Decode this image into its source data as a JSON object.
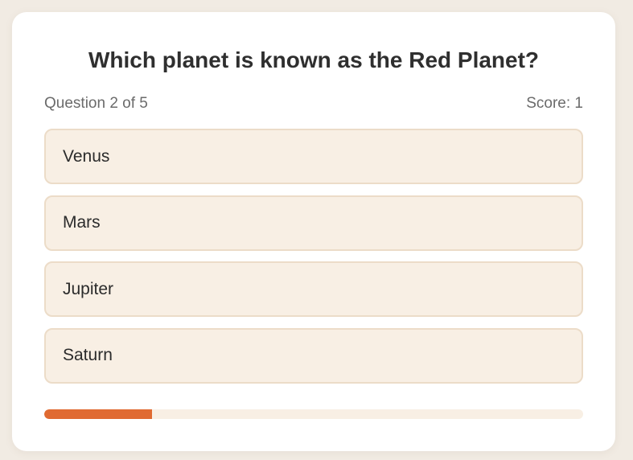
{
  "quiz": {
    "question": "Which planet is known as the Red Planet?",
    "progress_text": "Question 2 of 5",
    "score_text": "Score: 1",
    "options": [
      {
        "label": "Venus"
      },
      {
        "label": "Mars"
      },
      {
        "label": "Jupiter"
      },
      {
        "label": "Saturn"
      }
    ],
    "progress_fraction": 0.2,
    "colors": {
      "accent": "#e06a31",
      "option_bg": "#f8efe4",
      "option_border": "#ecdcc8",
      "page_bg": "#f1ebe3"
    }
  }
}
